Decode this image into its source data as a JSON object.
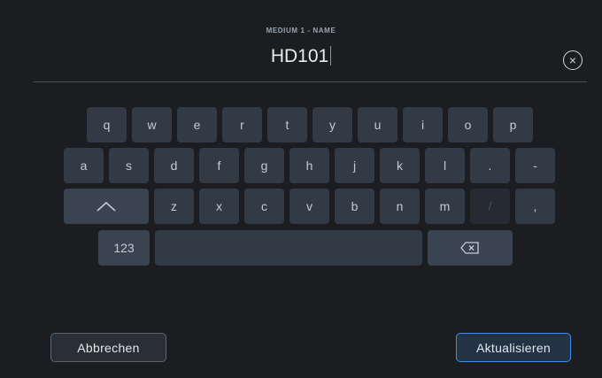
{
  "header": {
    "title": "MEDIUM 1 - NAME",
    "value": "HD101"
  },
  "keyboard": {
    "row1": [
      "q",
      "w",
      "e",
      "r",
      "t",
      "y",
      "u",
      "i",
      "o",
      "p"
    ],
    "row2": [
      "a",
      "s",
      "d",
      "f",
      "g",
      "h",
      "j",
      "k",
      "l",
      ".",
      "-"
    ],
    "row3": [
      "z",
      "x",
      "c",
      "v",
      "b",
      "n",
      "m",
      "/",
      ","
    ],
    "numbers_label": "123"
  },
  "footer": {
    "cancel_label": "Abbrechen",
    "update_label": "Aktualisieren"
  },
  "icons": {
    "clear": "clear-circle-icon",
    "shift": "shift-icon",
    "backspace": "backspace-icon"
  }
}
